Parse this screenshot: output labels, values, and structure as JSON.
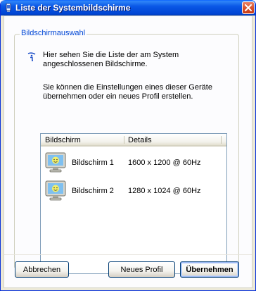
{
  "window": {
    "title": "Liste der Systembildschirme",
    "icons": {
      "app": "display-icon",
      "close": "close-icon"
    }
  },
  "groupbox": {
    "label": "Bildschirmauswahl",
    "info_line1": "Hier sehen Sie die Liste der am System angeschlossenen Bildschirme.",
    "info_line2": "Sie können die Einstellungen eines dieser Geräte übernehmen oder ein neues Profil erstellen.",
    "info_icon": "info-icon"
  },
  "listview": {
    "columns": [
      "Bildschirm",
      "Details"
    ],
    "rows": [
      {
        "name": "Bildschirm 1",
        "details": "1600 x 1200 @ 60Hz",
        "icon": "monitor-icon"
      },
      {
        "name": "Bildschirm 2",
        "details": "1280 x 1024 @ 60Hz",
        "icon": "monitor-icon"
      }
    ]
  },
  "buttons": {
    "cancel": "Abbrechen",
    "new_profile": "Neues Profil",
    "apply": "Übernehmen"
  },
  "colors": {
    "titlebar": "#0a57e6",
    "group_label": "#0046d5",
    "close_button": "#d8522c"
  }
}
